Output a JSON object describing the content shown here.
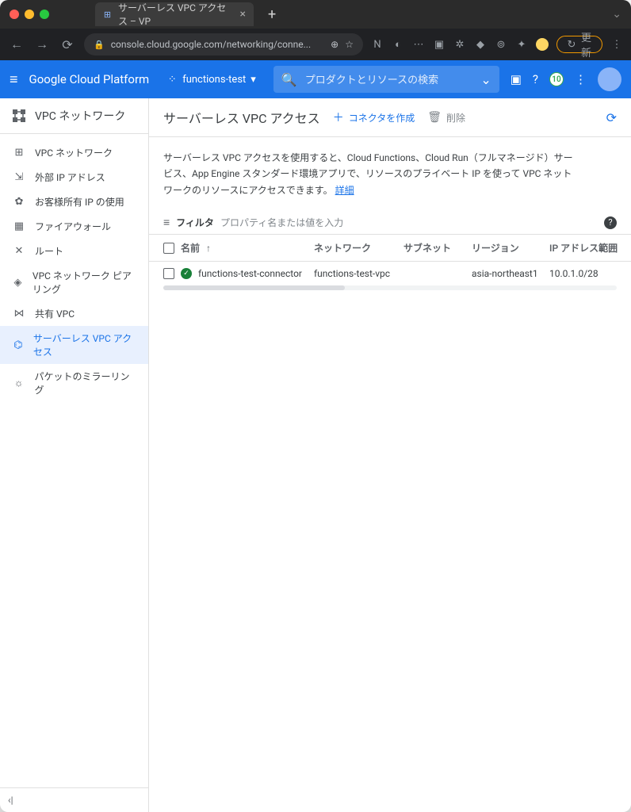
{
  "browser": {
    "tab_title": "サーバーレス VPC アクセス – VP",
    "url_display": "console.cloud.google.com/networking/conne...",
    "update_label": "更新"
  },
  "header": {
    "platform": "Google Cloud Platform",
    "project": "functions-test",
    "search_placeholder": "プロダクトとリソースの検索",
    "badge_number": "10"
  },
  "sidebar": {
    "title": "VPC ネットワーク",
    "items": [
      {
        "icon": "⊞",
        "label": "VPC ネットワーク"
      },
      {
        "icon": "⇲",
        "label": "外部 IP アドレス"
      },
      {
        "icon": "✿",
        "label": "お客様所有 IP の使用"
      },
      {
        "icon": "▦",
        "label": "ファイアウォール"
      },
      {
        "icon": "✕",
        "label": "ルート"
      },
      {
        "icon": "◈",
        "label": "VPC ネットワーク ピアリング"
      },
      {
        "icon": "⋈",
        "label": "共有 VPC"
      },
      {
        "icon": "⌬",
        "label": "サーバーレス VPC アクセス"
      },
      {
        "icon": "☼",
        "label": "パケットのミラーリング"
      }
    ],
    "collapse": "‹|"
  },
  "main": {
    "title": "サーバーレス VPC アクセス",
    "create_label": "コネクタを作成",
    "delete_label": "削除",
    "description_text": "サーバーレス VPC アクセスを使用すると、Cloud Functions、Cloud Run（フルマネージド）サービス、App Engine スタンダード環境アプリで、リソースのプライベート IP を使って VPC ネットワークのリソースにアクセスできます。",
    "description_link": "詳細",
    "filter_label": "フィルタ",
    "filter_placeholder": "プロパティ名または値を入力",
    "columns": {
      "name": "名前",
      "network": "ネットワーク",
      "subnet": "サブネット",
      "region": "リージョン",
      "ip": "IP アドレス範囲"
    },
    "rows": [
      {
        "name": "functions-test-connector",
        "network": "functions-test-vpc",
        "subnet": "",
        "region": "asia-northeast1",
        "ip": "10.0.1.0/28"
      }
    ]
  }
}
